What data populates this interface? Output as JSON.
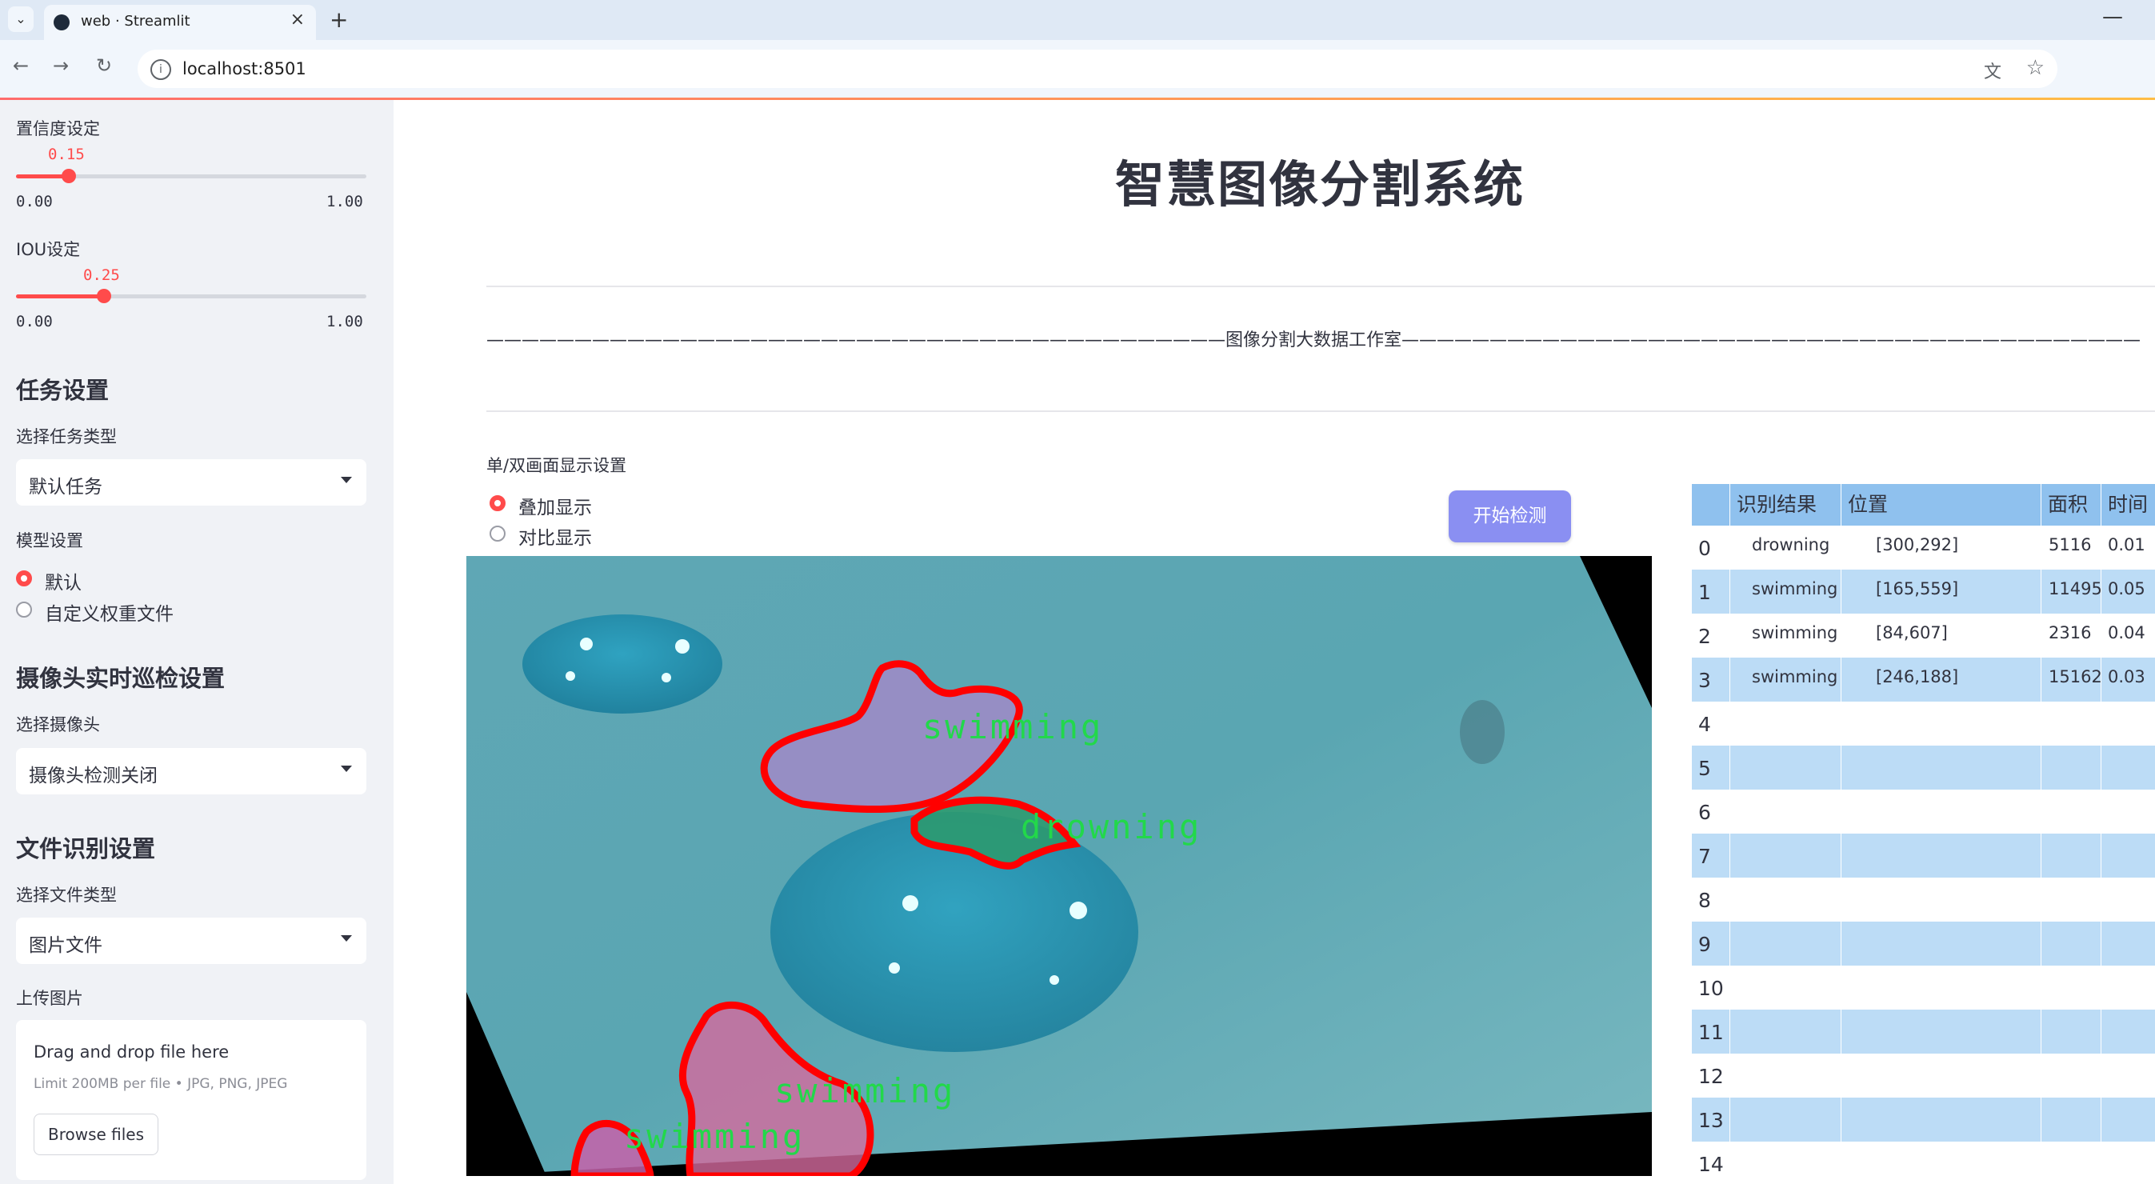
{
  "browser": {
    "tab_title": "web · Streamlit",
    "url": "localhost:8501"
  },
  "sidebar": {
    "confidence": {
      "label": "置信度设定",
      "value": "0.15",
      "value_fraction": 0.15,
      "min": "0.00",
      "max": "1.00"
    },
    "iou": {
      "label": "IOU设定",
      "value": "0.25",
      "value_fraction": 0.25,
      "min": "0.00",
      "max": "1.00"
    },
    "task_settings": {
      "heading": "任务设置",
      "select_label": "选择任务类型",
      "selected": "默认任务"
    },
    "model_settings": {
      "label": "模型设置",
      "options": [
        "默认",
        "自定义权重文件"
      ],
      "selected_index": 0
    },
    "camera": {
      "heading": "摄像头实时巡检设置",
      "select_label": "选择摄像头",
      "selected": "摄像头检测关闭"
    },
    "file_settings": {
      "heading": "文件识别设置",
      "select_label": "选择文件类型",
      "selected": "图片文件"
    },
    "upload": {
      "label": "上传图片",
      "drop_text": "Drag and drop file here",
      "limit_text": "Limit 200MB per file • JPG, PNG, JPEG",
      "browse_label": "Browse files"
    }
  },
  "main": {
    "title": "智慧图像分割系统",
    "subtitle_line": "——————————————————————————————————————————图像分割大数据工作室——————————————————————————————————————————",
    "display_setting": {
      "label": "单/双画面显示设置",
      "options": [
        "叠加显示",
        "对比显示"
      ],
      "selected_index": 0
    },
    "start_button": "开始检测",
    "detections": [
      {
        "label": "swimming"
      },
      {
        "label": "drowning"
      },
      {
        "label": "swimming"
      },
      {
        "label": "swimming"
      }
    ]
  },
  "results_table": {
    "columns": [
      "",
      "识别结果",
      "位置",
      "面积",
      "时间"
    ],
    "rows": [
      {
        "index": "0",
        "result": "drowning",
        "position": "[300,292]",
        "area": "5116",
        "time": "0.01"
      },
      {
        "index": "1",
        "result": "swimming",
        "position": "[165,559]",
        "area": "11495",
        "time": "0.05"
      },
      {
        "index": "2",
        "result": "swimming",
        "position": "[84,607]",
        "area": "2316",
        "time": "0.04"
      },
      {
        "index": "3",
        "result": "swimming",
        "position": "[246,188]",
        "area": "15162",
        "time": "0.03"
      },
      {
        "index": "4",
        "result": "",
        "position": "",
        "area": "",
        "time": ""
      },
      {
        "index": "5",
        "result": "",
        "position": "",
        "area": "",
        "time": ""
      },
      {
        "index": "6",
        "result": "",
        "position": "",
        "area": "",
        "time": ""
      },
      {
        "index": "7",
        "result": "",
        "position": "",
        "area": "",
        "time": ""
      },
      {
        "index": "8",
        "result": "",
        "position": "",
        "area": "",
        "time": ""
      },
      {
        "index": "9",
        "result": "",
        "position": "",
        "area": "",
        "time": ""
      },
      {
        "index": "10",
        "result": "",
        "position": "",
        "area": "",
        "time": ""
      },
      {
        "index": "11",
        "result": "",
        "position": "",
        "area": "",
        "time": ""
      },
      {
        "index": "12",
        "result": "",
        "position": "",
        "area": "",
        "time": ""
      },
      {
        "index": "13",
        "result": "",
        "position": "",
        "area": "",
        "time": ""
      },
      {
        "index": "14",
        "result": "",
        "position": "",
        "area": "",
        "time": ""
      }
    ]
  },
  "colors": {
    "accent": "#ff4b4b",
    "button": "#8a8ff2",
    "table_header": "#8fc1ee",
    "table_stripe": "#bcdcf6",
    "mask_outline": "#ff0000",
    "label_text": "#22d84a"
  }
}
